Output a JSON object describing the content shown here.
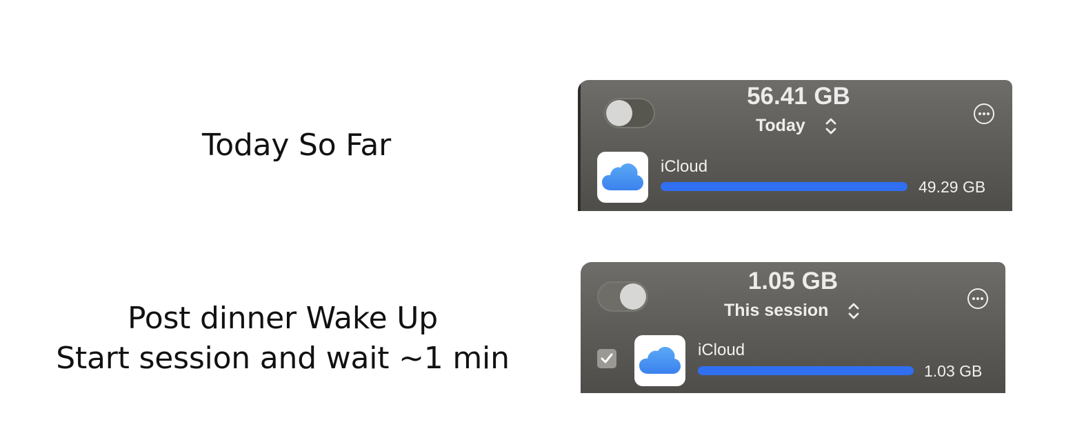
{
  "captions": {
    "first": "Today So Far",
    "second_line1": "Post dinner Wake Up",
    "second_line2": "Start session and wait ~1 min"
  },
  "panels": [
    {
      "toggle_state": "off",
      "total": "56.41 GB",
      "period": "Today",
      "app": {
        "name": "iCloud",
        "icon": "icloud-icon",
        "amount": "49.29 GB",
        "fill": 1.0,
        "checked": false
      }
    },
    {
      "toggle_state": "on",
      "total": "1.05 GB",
      "period": "This session",
      "app": {
        "name": "iCloud",
        "icon": "icloud-icon",
        "amount": "1.03 GB",
        "fill": 1.0,
        "checked": true
      }
    }
  ],
  "colors": {
    "bar": "#2f6ff0",
    "panel": "#605e5a"
  }
}
